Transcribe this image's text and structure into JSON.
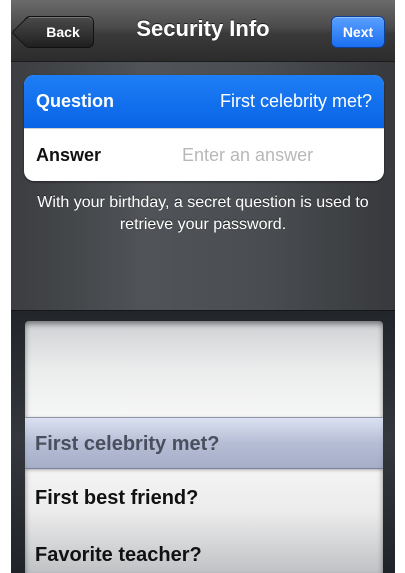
{
  "navbar": {
    "back_label": "Back",
    "title": "Security Info",
    "next_label": "Next"
  },
  "form": {
    "question": {
      "label": "Question",
      "value": "First celebrity met?"
    },
    "answer": {
      "label": "Answer",
      "placeholder": "Enter an answer",
      "value": ""
    }
  },
  "help_text": "With your birthday, a secret question is used to retrieve your password.",
  "picker": {
    "selected": "First celebrity met?",
    "options": [
      "First celebrity met?",
      "First best friend?",
      "Favorite teacher?"
    ]
  },
  "colors": {
    "accent": "#0a64e6",
    "nav_background": "#3a3a3a"
  }
}
